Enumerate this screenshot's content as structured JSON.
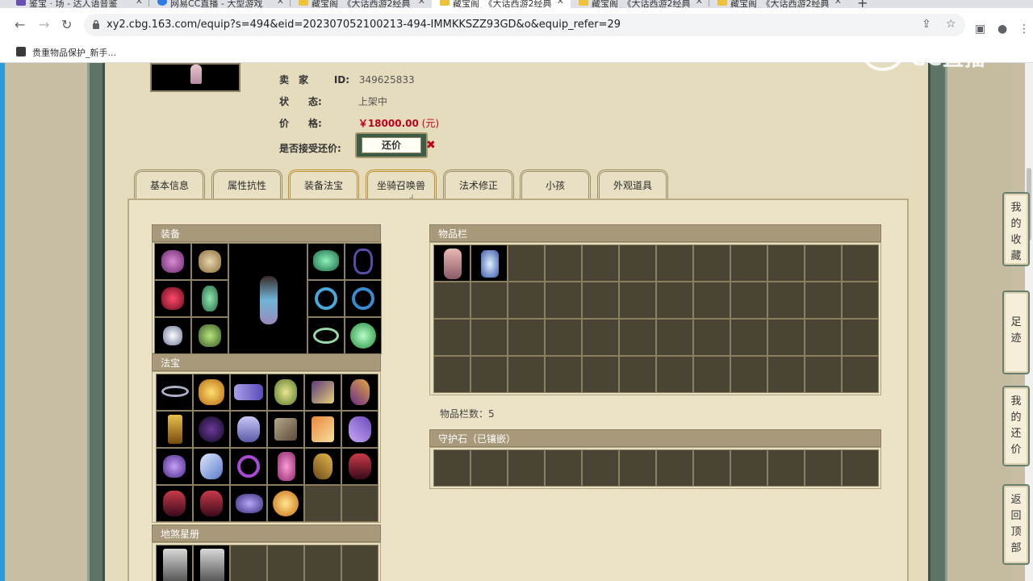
{
  "browser": {
    "tabs": [
      {
        "label": "鉴宝 · 场 - 达人语音鉴",
        "active": false
      },
      {
        "label": "网易CC直播 - 大型游戏",
        "active": false
      },
      {
        "label": "藏宝阁_《大话西游2经典",
        "active": false
      },
      {
        "label": "藏宝阁_《大话西游2经典",
        "active": true
      },
      {
        "label": "藏宝阁_《大话西游2经典",
        "active": false
      },
      {
        "label": "藏宝阁_《大话西游2经典",
        "active": false
      }
    ],
    "url": "xy2.cbg.163.com/equip?s=494&eid=202307052100213-494-IMMKKSZZ93GD&o&equip_refer=29",
    "bookmark": "贵重物品保护_新手...",
    "watermark": "CC直播"
  },
  "seller": {
    "seller_label": "卖　家",
    "id_label": "ID:",
    "id_value": "349625833",
    "status_label": "状　　态:",
    "status_value": "上架中",
    "price_label": "价　　格:",
    "price_value": "￥18000.00",
    "price_unit": "(元)",
    "counter_label": "是否接受还价:",
    "counter_button": "还价"
  },
  "tabs": [
    "基本信息",
    "属性抗性",
    "装备法宝",
    "坐骑召唤兽",
    "法术修正",
    "小孩",
    "外观道具"
  ],
  "panels": {
    "equipment": "装备",
    "fabao": "法宝",
    "dishaxingce": "地煞星册",
    "inventory": "物品栏",
    "inventory_count_label": "物品栏数：",
    "inventory_count": "5",
    "guard_stone": "守护石（已镶嵌）"
  },
  "side_buttons": [
    "我的收藏",
    "足迹",
    "我的还价",
    "返回顶部"
  ],
  "colors": {
    "accent_red": "#c0001a",
    "panel_head": "#a7997a",
    "cell_bg": "#4a4434",
    "rail": "#5e7466"
  }
}
